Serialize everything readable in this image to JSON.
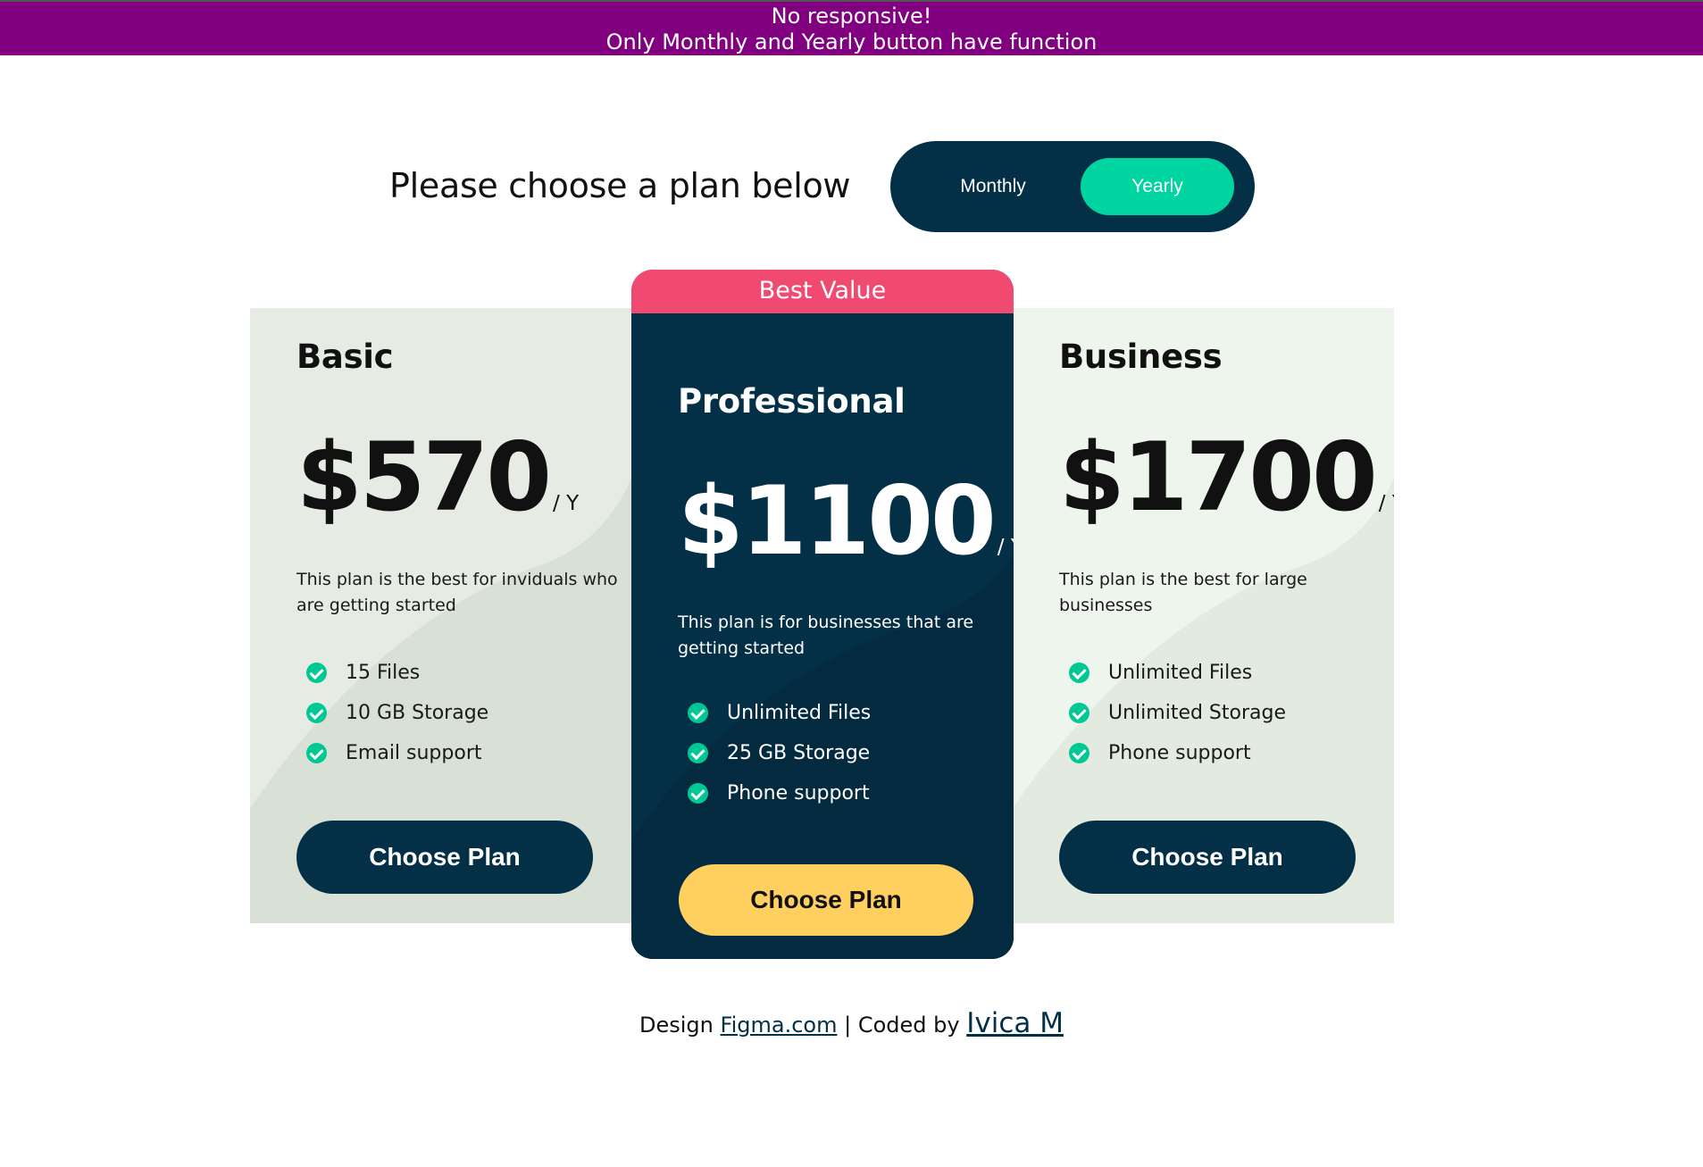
{
  "banner": {
    "line1": "No responsive!",
    "line2": "Only Monthly and Yearly button have function"
  },
  "heading": "Please choose a plan below",
  "toggle": {
    "monthly": "Monthly",
    "yearly": "Yearly",
    "selected": "Yearly"
  },
  "plans": [
    {
      "name": "Basic",
      "price": "$570",
      "period": "/ Y",
      "description": "This plan is the best for inviduals who are getting started",
      "features": [
        "15 Files",
        "10 GB Storage",
        "Email support"
      ],
      "button": "Choose Plan"
    },
    {
      "badge": "Best Value",
      "name": "Professional",
      "price": "$1100",
      "period": "/ Y",
      "description": "This plan is for businesses that are getting started",
      "features": [
        "Unlimited Files",
        "25 GB Storage",
        "Phone support"
      ],
      "button": "Choose Plan"
    },
    {
      "name": "Business",
      "price": "$1700",
      "period": "/ Y",
      "description": "This plan is the best for large businesses",
      "features": [
        "Unlimited Files",
        "Unlimited Storage",
        "Phone support"
      ],
      "button": "Choose Plan"
    }
  ],
  "footer": {
    "design_prefix": "Design",
    "design_link": "Figma.com",
    "separator": "| Coded by",
    "author_link": "Ivica M"
  },
  "colors": {
    "banner": "#800080",
    "navy": "#032f47",
    "accent_green": "#00d4a0",
    "ribbon_pink": "#f04a70",
    "button_yellow": "#ffcf5f"
  },
  "icons": [
    "check-icon"
  ]
}
